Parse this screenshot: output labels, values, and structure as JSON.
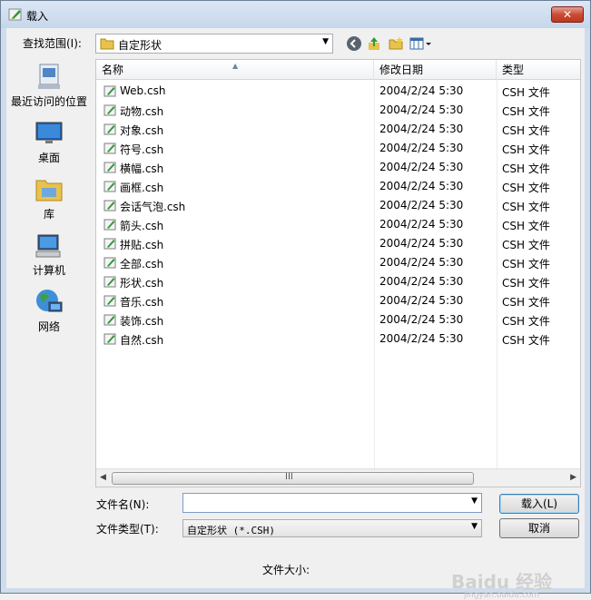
{
  "window": {
    "title": "载入",
    "close_label": "✕"
  },
  "lookin": {
    "label": "查找范围(I):",
    "value": "自定形状"
  },
  "places": [
    {
      "id": "recent",
      "label": "最近访问的位置",
      "icon": "recent-places-icon"
    },
    {
      "id": "desktop",
      "label": "桌面",
      "icon": "desktop-icon"
    },
    {
      "id": "libraries",
      "label": "库",
      "icon": "libraries-icon"
    },
    {
      "id": "computer",
      "label": "计算机",
      "icon": "computer-icon"
    },
    {
      "id": "network",
      "label": "网络",
      "icon": "network-icon"
    }
  ],
  "columns": {
    "name": "名称",
    "date": "修改日期",
    "type": "类型"
  },
  "files": [
    {
      "name": "Web.csh",
      "date": "2004/2/24 5:30",
      "type": "CSH 文件"
    },
    {
      "name": "动物.csh",
      "date": "2004/2/24 5:30",
      "type": "CSH 文件"
    },
    {
      "name": "对象.csh",
      "date": "2004/2/24 5:30",
      "type": "CSH 文件"
    },
    {
      "name": "符号.csh",
      "date": "2004/2/24 5:30",
      "type": "CSH 文件"
    },
    {
      "name": "横幅.csh",
      "date": "2004/2/24 5:30",
      "type": "CSH 文件"
    },
    {
      "name": "画框.csh",
      "date": "2004/2/24 5:30",
      "type": "CSH 文件"
    },
    {
      "name": "会话气泡.csh",
      "date": "2004/2/24 5:30",
      "type": "CSH 文件"
    },
    {
      "name": "箭头.csh",
      "date": "2004/2/24 5:30",
      "type": "CSH 文件"
    },
    {
      "name": "拼贴.csh",
      "date": "2004/2/24 5:30",
      "type": "CSH 文件"
    },
    {
      "name": "全部.csh",
      "date": "2004/2/24 5:30",
      "type": "CSH 文件"
    },
    {
      "name": "形状.csh",
      "date": "2004/2/24 5:30",
      "type": "CSH 文件"
    },
    {
      "name": "音乐.csh",
      "date": "2004/2/24 5:30",
      "type": "CSH 文件"
    },
    {
      "name": "装饰.csh",
      "date": "2004/2/24 5:30",
      "type": "CSH 文件"
    },
    {
      "name": "自然.csh",
      "date": "2004/2/24 5:30",
      "type": "CSH 文件"
    }
  ],
  "form": {
    "filename_label": "文件名(N):",
    "filename_value": "",
    "filetype_label": "文件类型(T):",
    "filetype_value": "自定形状 (*.CSH)",
    "load_button": "载入(L)",
    "cancel_button": "取消",
    "filesize_label": "文件大小:"
  },
  "scrollbar": {
    "grip": "III"
  },
  "watermark": {
    "text": "Baidu 经验",
    "sub": "jingyan.baidu.com"
  },
  "colors": {
    "accent": "#3c7fb1",
    "titlebar": "#cfdcec",
    "close": "#c94b35"
  }
}
